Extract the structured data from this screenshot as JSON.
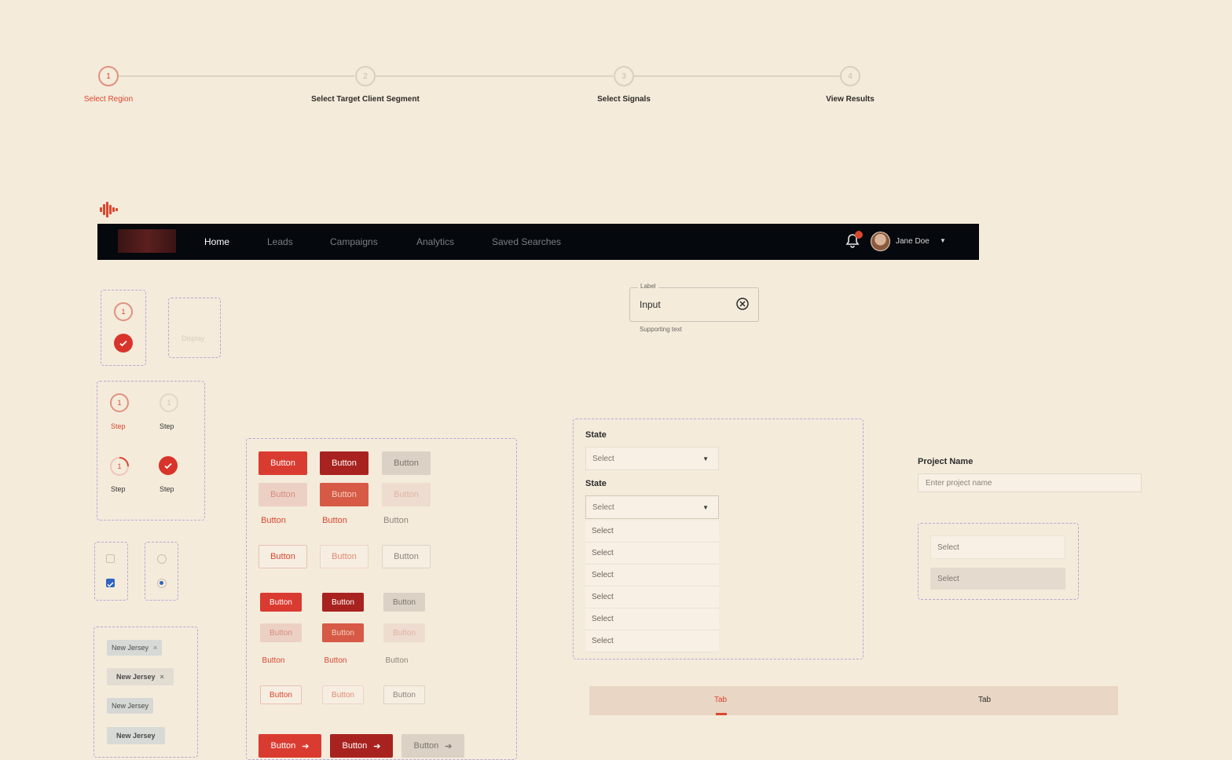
{
  "stepper": {
    "steps": [
      {
        "number": "1",
        "label": "Select Region"
      },
      {
        "number": "2",
        "label": "Select Target Client Segment"
      },
      {
        "number": "3",
        "label": "Select Signals"
      },
      {
        "number": "4",
        "label": "View Results"
      }
    ]
  },
  "navbar": {
    "links": [
      "Home",
      "Leads",
      "Campaigns",
      "Analytics",
      "Saved Searches"
    ],
    "active": "Home",
    "notification_count": "1",
    "user_name": "Jane Doe"
  },
  "components": {
    "step_variants": {
      "number": "1",
      "step_label": "Step"
    },
    "placeholder_box": "Display",
    "button_label": "Button"
  },
  "text_field": {
    "label": "Label",
    "value": "Input",
    "supporting_text": "Supporting text"
  },
  "state_select": {
    "label": "State",
    "placeholder": "Select",
    "options": [
      "Select",
      "Select",
      "Select",
      "Select",
      "Select",
      "Select"
    ]
  },
  "project_name": {
    "label": "Project Name",
    "placeholder": "Enter project name"
  },
  "select_states": [
    "Select",
    "Select"
  ],
  "chips": [
    "New Jersey",
    "New Jersey",
    "New Jersey",
    "New Jersey"
  ],
  "tabs": [
    "Tab",
    "Tab"
  ],
  "colors": {
    "accent": "#d9472f",
    "accent_dark": "#a8231f",
    "nav_bg": "#05080c",
    "page_bg": "#f4ebdb",
    "dashed_border": "#b7a8d6"
  }
}
